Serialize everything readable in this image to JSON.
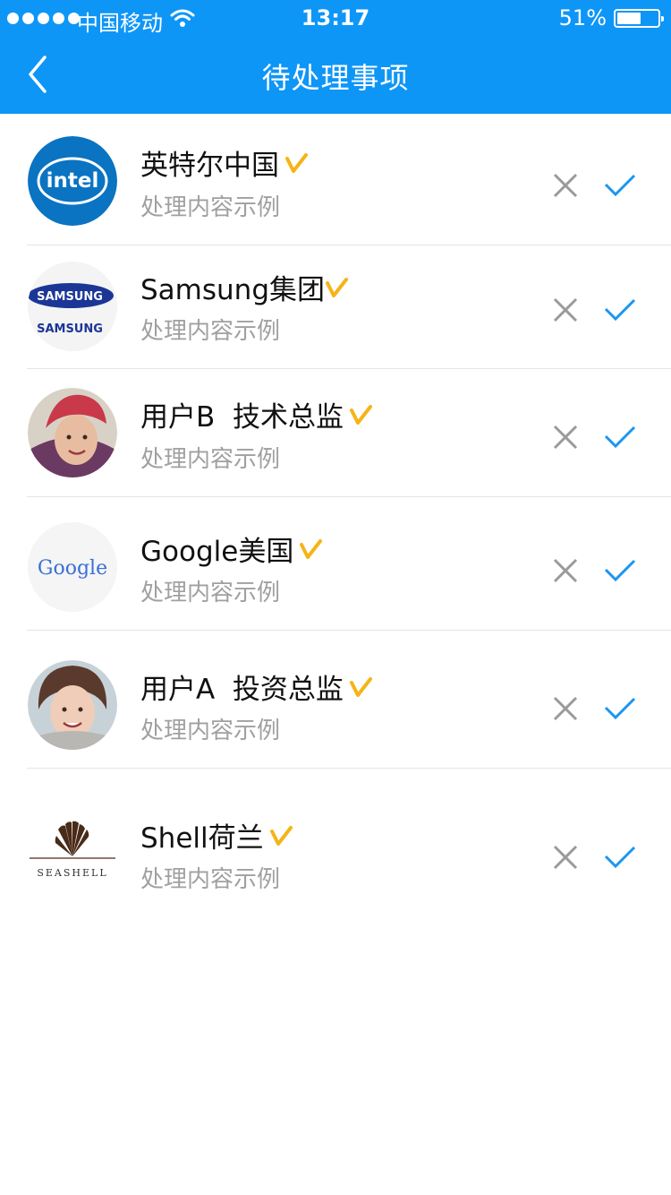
{
  "status_bar": {
    "carrier": "中国移动",
    "time": "13:17",
    "battery_percent_label": "51%",
    "battery_level": 0.51,
    "signal_dots": 5
  },
  "nav": {
    "title": "待处理事项",
    "back_icon": "chevron-left-icon"
  },
  "colors": {
    "header_bg": "#0e96f7",
    "accept": "#1a96f0",
    "reject": "#9a9a9a",
    "badge": "#f5b417",
    "subtitle": "#a0a0a0"
  },
  "items": [
    {
      "name": "英特尔中国",
      "subtitle": "处理内容示例",
      "avatar": "intel-logo",
      "badge": "v-badge-icon"
    },
    {
      "name": "Samsung集团",
      "subtitle": "处理内容示例",
      "avatar": "samsung-logo",
      "badge": "v-badge-icon"
    },
    {
      "name": "用户B  技术总监",
      "subtitle": "处理内容示例",
      "avatar": "user-photo",
      "badge": "v-badge-icon"
    },
    {
      "name": "Google美国",
      "subtitle": "处理内容示例",
      "avatar": "google-logo",
      "badge": "v-badge-icon"
    },
    {
      "name": "用户A  投资总监",
      "subtitle": "处理内容示例",
      "avatar": "user-photo",
      "badge": "v-badge-icon"
    },
    {
      "name": "Shell荷兰",
      "subtitle": "处理内容示例",
      "avatar": "seashell-logo",
      "badge": "v-badge-icon"
    }
  ],
  "logos": {
    "intel": "intel",
    "samsung": "SAMSUNG",
    "google": "Google",
    "seashell": "SEASHELL"
  }
}
